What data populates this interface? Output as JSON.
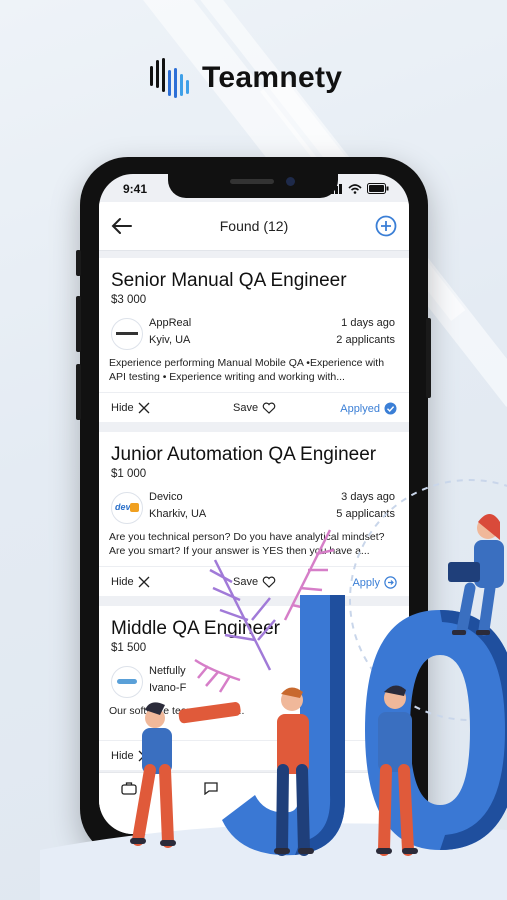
{
  "brand": {
    "name": "Teamnety",
    "logo_colors": [
      "#111111",
      "#2d6fd6",
      "#3ea0e8"
    ]
  },
  "status_bar": {
    "time": "9:41"
  },
  "header": {
    "title": "Found (12)"
  },
  "jobs": [
    {
      "title": "Senior Manual QA Engineer",
      "salary": "$3 000",
      "company": "AppReal",
      "location": "Kyiv, UA",
      "posted": "1 days ago",
      "applicants": "2 applicants",
      "description": "Experience performing Manual Mobile QA •Experience with API testing • Experience writing and working with...",
      "hide_label": "Hide",
      "save_label": "Save",
      "apply_label": "Applyed"
    },
    {
      "title": "Junior Automation QA Engineer",
      "salary": "$1 000",
      "company": "Devico",
      "location": "Kharkiv, UA",
      "posted": "3 days ago",
      "applicants": "5 applicants",
      "description": "Are you technical person? Do you have analytical mindset? Are you smart? If your answer is YES then you have a...",
      "hide_label": "Hide",
      "save_label": "Save",
      "apply_label": "Apply"
    },
    {
      "title": "Middle QA Engineer",
      "salary": "$1 500",
      "company": "Netfully",
      "location": "Ivano-F",
      "description": "Our software team... tested...",
      "hide_label": "Hide"
    }
  ],
  "colors": {
    "accent": "#3b7fd6",
    "letters": "#3a78d4",
    "letters_dark": "#1f4f9e"
  }
}
